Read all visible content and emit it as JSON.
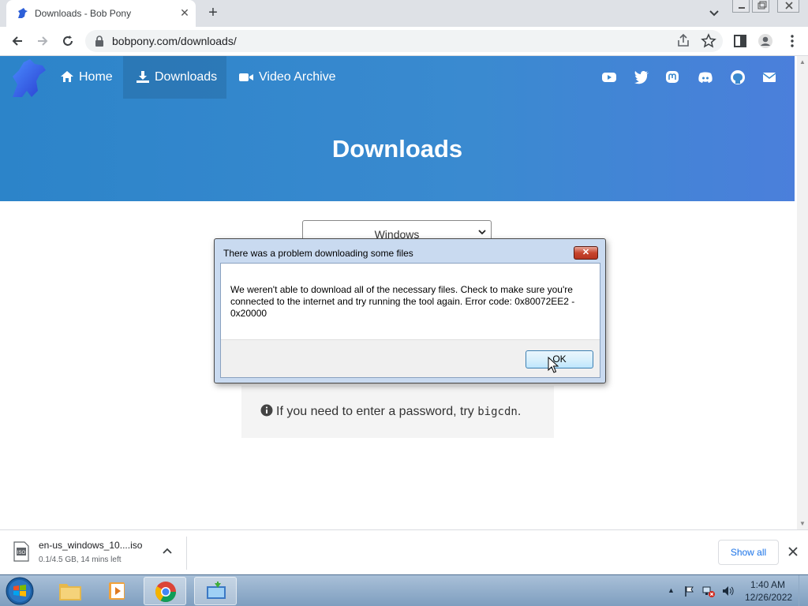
{
  "browser": {
    "tab_title": "Downloads - Bob Pony",
    "tab_close_glyph": "✕",
    "new_tab_glyph": "+",
    "url": "bobpony.com/downloads/"
  },
  "nav": {
    "items": [
      {
        "label": "Home",
        "icon": "home-icon"
      },
      {
        "label": "Downloads",
        "icon": "download-icon",
        "active": true
      },
      {
        "label": "Video Archive",
        "icon": "video-icon"
      }
    ],
    "socials": [
      "youtube-icon",
      "twitter-icon",
      "mastodon-icon",
      "discord-icon",
      "github-icon",
      "mail-icon"
    ]
  },
  "hero": {
    "title": "Downloads",
    "color_start": "#2c84c9",
    "color_end": "#4b7fdb"
  },
  "select": {
    "value": "Windows"
  },
  "note": {
    "text": "If you need to enter a password, try ",
    "code": "bigcdn",
    "suffix": "."
  },
  "dialog": {
    "title": "There was a problem downloading some files",
    "close_glyph": "✕",
    "message": "We weren't able to download all of the necessary files. Check to make sure you're connected to the internet and try running the tool again. Error code: 0x80072EE2 - 0x20000",
    "ok_label": "OK"
  },
  "download_shelf": {
    "file_name": "en-us_windows_10....iso",
    "status": "0.1/4.5 GB, 14 mins left",
    "show_all_label": "Show all",
    "file_icon_label": "ISO"
  },
  "taskbar": {
    "apps": [
      "explorer-icon",
      "media-player-icon",
      "chrome-icon",
      "media-creation-tool-icon"
    ],
    "time": "1:40 AM",
    "date": "12/26/2022"
  }
}
